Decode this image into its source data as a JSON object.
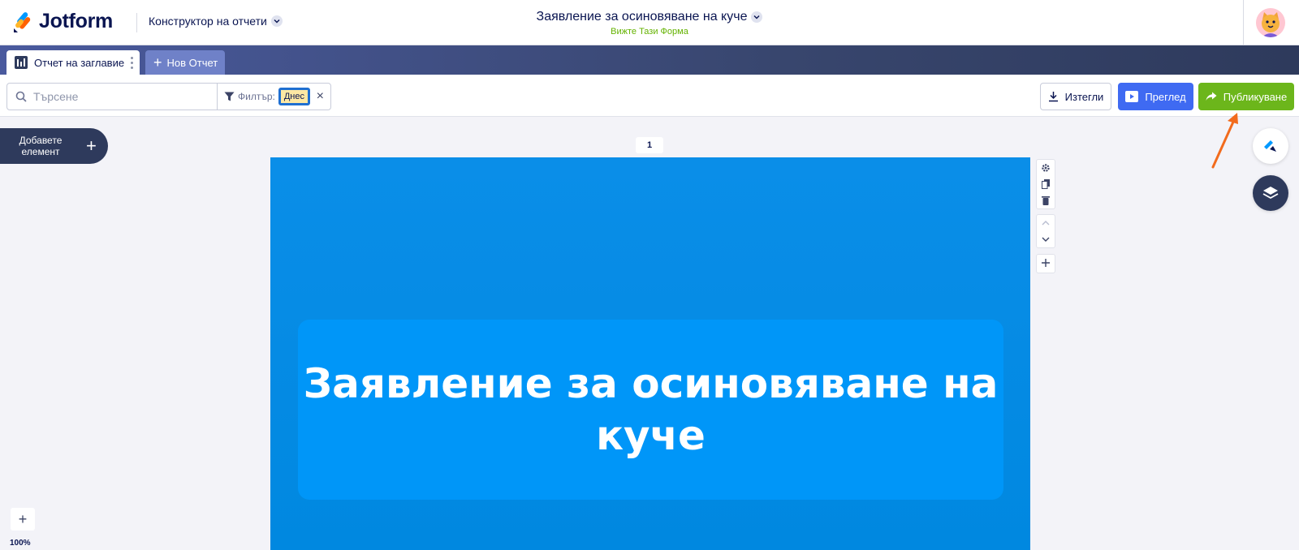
{
  "header": {
    "logo_text": "Jotform",
    "builder_label": "Конструктор на отчети",
    "form_title": "Заявление за осиновяване на куче",
    "form_subtitle": "Вижте Тази Форма"
  },
  "tabs": {
    "active_label": "Отчет на заглавие",
    "new_label": "Нов Отчет"
  },
  "toolbar": {
    "search_placeholder": "Търсене",
    "filter_label": "Филтър:",
    "filter_value": "Днес",
    "export_label": "Изтегли",
    "preview_label": "Преглед",
    "publish_label": "Публикуване"
  },
  "canvas": {
    "add_element_label": "Добавете елемент",
    "page_number": "1",
    "report_title": "Заявление за осиновяване на куче",
    "zoom_level": "100%"
  },
  "colors": {
    "brand_dark": "#0a1551",
    "publish_green": "#6cb61b",
    "preview_blue": "#3f6af2",
    "page_blue": "#0088e0",
    "title_box_blue": "#0096f8",
    "annotation_orange": "#f26b1d"
  }
}
